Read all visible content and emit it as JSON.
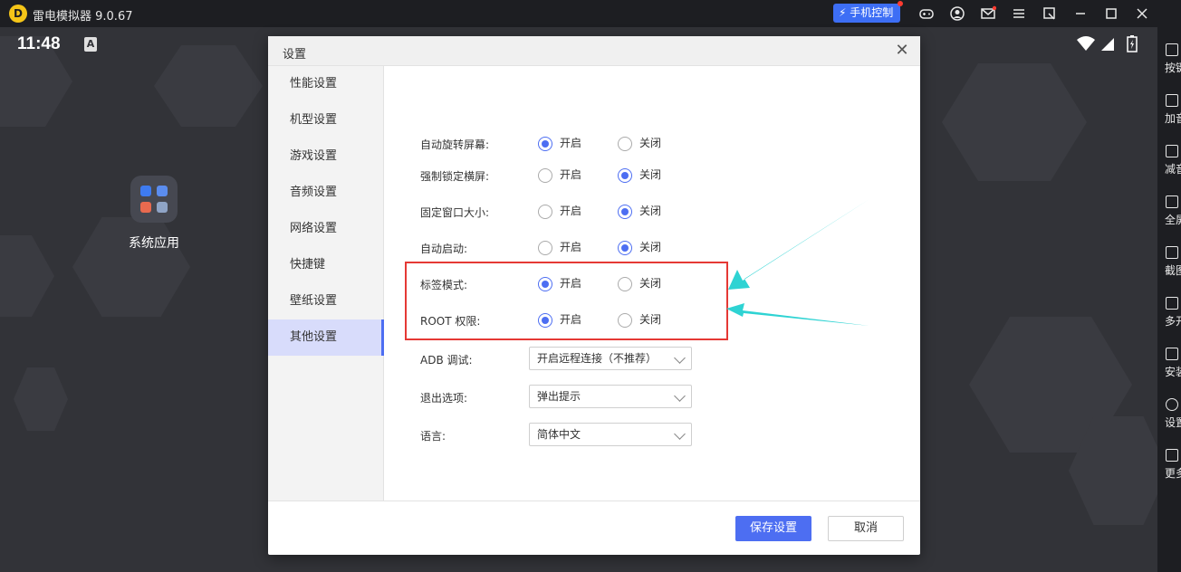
{
  "titlebar": {
    "app_title": "雷电模拟器 9.0.67",
    "phone_control": "手机控制",
    "icons": [
      "gamepad-icon",
      "account-icon",
      "mail-icon",
      "menu-icon",
      "popout-icon",
      "minimize-icon",
      "maximize-icon",
      "close-icon"
    ]
  },
  "android": {
    "time": "11:48",
    "status_badge": "A",
    "folder_label": "系统应用"
  },
  "right_toolbar": {
    "items": [
      {
        "label": "按键",
        "icon": "keyboard-icon"
      },
      {
        "label": "加音量",
        "icon": "volume-up-icon"
      },
      {
        "label": "减音量",
        "icon": "volume-down-icon"
      },
      {
        "label": "全屏",
        "icon": "fullscreen-icon"
      },
      {
        "label": "截图",
        "icon": "scissors-icon"
      },
      {
        "label": "多开",
        "icon": "multi-open-icon"
      },
      {
        "label": "安装",
        "icon": "apk-icon"
      },
      {
        "label": "设置",
        "icon": "gear-icon"
      },
      {
        "label": "更多",
        "icon": "more-icon"
      }
    ]
  },
  "dialog": {
    "title": "设置",
    "nav": [
      {
        "label": "性能设置",
        "active": false
      },
      {
        "label": "机型设置",
        "active": false
      },
      {
        "label": "游戏设置",
        "active": false
      },
      {
        "label": "音频设置",
        "active": false
      },
      {
        "label": "网络设置",
        "active": false
      },
      {
        "label": "快捷键",
        "active": false
      },
      {
        "label": "壁纸设置",
        "active": false
      },
      {
        "label": "其他设置",
        "active": true
      }
    ],
    "on_label": "开启",
    "off_label": "关闭",
    "settings": [
      {
        "label": "自动旋转屏幕:",
        "value": "on"
      },
      {
        "label": "强制锁定横屏:",
        "value": "off"
      },
      {
        "label": "固定窗口大小:",
        "value": "off"
      },
      {
        "label": "自动启动:",
        "value": "off"
      },
      {
        "label": "标签模式:",
        "value": "on"
      },
      {
        "label": "ROOT 权限:",
        "value": "on"
      }
    ],
    "adb": {
      "label": "ADB 调试:",
      "value": "开启远程连接（不推荐）"
    },
    "exit": {
      "label": "退出选项:",
      "value": "弹出提示"
    },
    "language": {
      "label": "语言:",
      "value": "简体中文"
    },
    "save_label": "保存设置",
    "cancel_label": "取消"
  },
  "colors": {
    "accent": "#4d6ef2",
    "annotation_box": "#e53935",
    "annotation_arrow": "#2ed3d3"
  }
}
